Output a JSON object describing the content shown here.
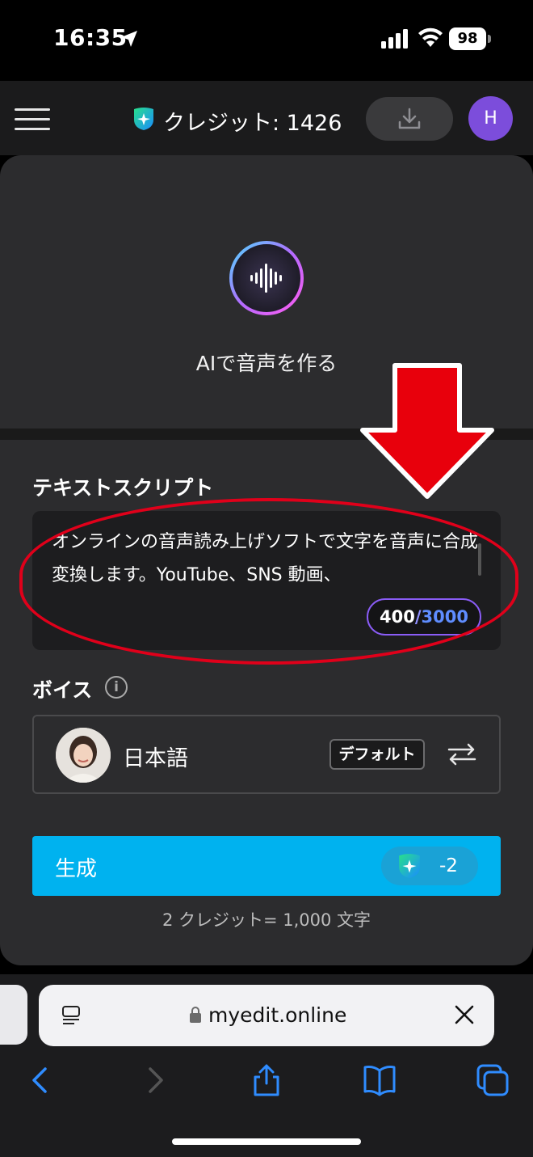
{
  "status": {
    "time": "16:35",
    "battery": "98"
  },
  "header": {
    "credit_text": "クレジット: 1426",
    "avatar_initial": "H"
  },
  "hero": {
    "title": "AIで音声を作る"
  },
  "script": {
    "label": "テキストスクリプト",
    "text": "オンラインの音声読み上げソフトで文字を音声に合成変換します。YouTube、SNS 動画、",
    "count_used": "400",
    "count_sep": "/",
    "count_total": "3000"
  },
  "voice": {
    "label": "ボイス",
    "info": "i",
    "language": "日本語",
    "badge": "デフォルト"
  },
  "generate": {
    "label": "生成",
    "cost": "-2",
    "note": "2 クレジット= 1,000 文字"
  },
  "browser": {
    "url": "myedit.online"
  },
  "colors": {
    "accent_blue": "#00b2ef",
    "purple": "#7c4ddb",
    "annotation_red": "#e0001a"
  }
}
